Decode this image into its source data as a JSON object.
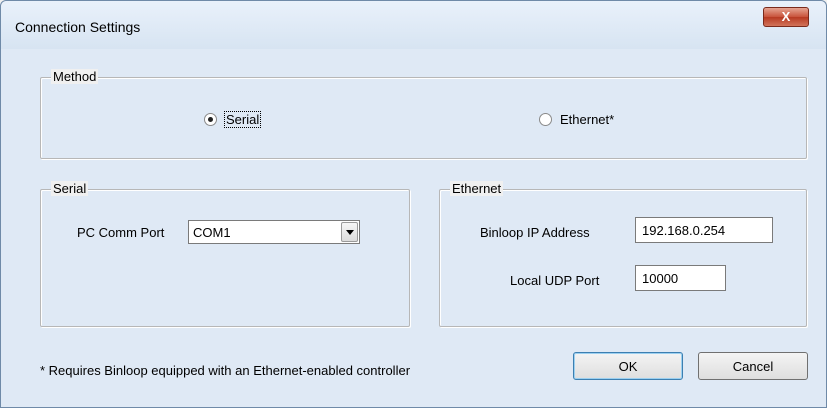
{
  "window": {
    "title": "Connection Settings",
    "close_label": "X"
  },
  "method": {
    "label": "Method",
    "options": [
      {
        "label": "Serial",
        "selected": true
      },
      {
        "label": "Ethernet*",
        "selected": false
      }
    ]
  },
  "serial": {
    "label": "Serial",
    "port_label": "PC Comm Port",
    "port_value": "COM1"
  },
  "ethernet": {
    "label": "Ethernet",
    "ip_label": "Binloop IP Address",
    "ip_value": "192.168.0.254",
    "udp_label": "Local UDP Port",
    "udp_value": "10000"
  },
  "footer": {
    "note": "* Requires Binloop equipped with an Ethernet-enabled controller",
    "ok_label": "OK",
    "cancel_label": "Cancel"
  }
}
